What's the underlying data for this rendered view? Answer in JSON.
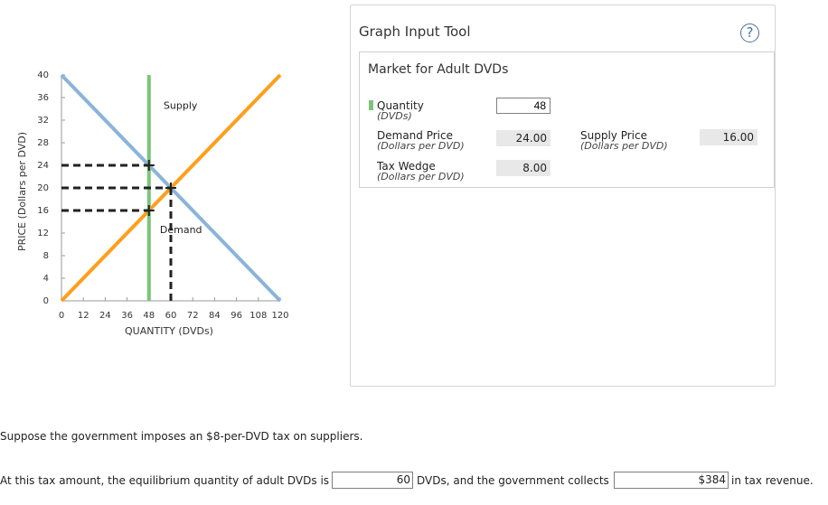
{
  "chart_data": {
    "type": "line",
    "xlabel": "QUANTITY (DVDs)",
    "ylabel": "PRICE (Dollars per DVD)",
    "xlim": [
      0,
      120
    ],
    "ylim": [
      0,
      40
    ],
    "xticks": [
      0,
      12,
      24,
      36,
      48,
      60,
      72,
      84,
      96,
      108,
      120
    ],
    "yticks": [
      0,
      4,
      8,
      12,
      16,
      20,
      24,
      28,
      32,
      36,
      40
    ],
    "series": [
      {
        "name": "Supply",
        "color": "#ff9e1b",
        "points": [
          [
            0,
            0
          ],
          [
            120,
            40
          ]
        ]
      },
      {
        "name": "Demand",
        "color": "#8ab4d8",
        "points": [
          [
            0,
            40
          ],
          [
            120,
            0
          ]
        ]
      }
    ],
    "quantity_line": {
      "x": 48,
      "color": "#7cc576"
    },
    "dashed_levels": [
      24,
      20,
      16
    ],
    "dashed_quantity": 60,
    "markers": [
      [
        48,
        24
      ],
      [
        48,
        16
      ],
      [
        60,
        20
      ]
    ],
    "annotations": [
      {
        "text": "Supply",
        "x": 56,
        "y": 34
      },
      {
        "text": "Demand",
        "x": 54,
        "y": 12
      }
    ]
  },
  "tool": {
    "title": "Graph Input Tool",
    "help": "?",
    "panel_title": "Market for Adult DVDs",
    "quantity": {
      "label": "Quantity",
      "unit": "(DVDs)",
      "value": "48"
    },
    "demand_price": {
      "label": "Demand Price",
      "unit": "(Dollars per DVD)",
      "value": "24.00"
    },
    "supply_price": {
      "label": "Supply Price",
      "unit": "(Dollars per DVD)",
      "value": "16.00"
    },
    "tax_wedge": {
      "label": "Tax Wedge",
      "unit": "(Dollars per DVD)",
      "value": "8.00"
    }
  },
  "question": {
    "intro": "Suppose the government imposes an $8-per-DVD tax on suppliers.",
    "part1": "At this tax amount, the equilibrium quantity of adult DVDs is",
    "answer1": "60",
    "part2": "DVDs, and the government collects",
    "answer2": "$384",
    "part3": "in tax revenue."
  }
}
